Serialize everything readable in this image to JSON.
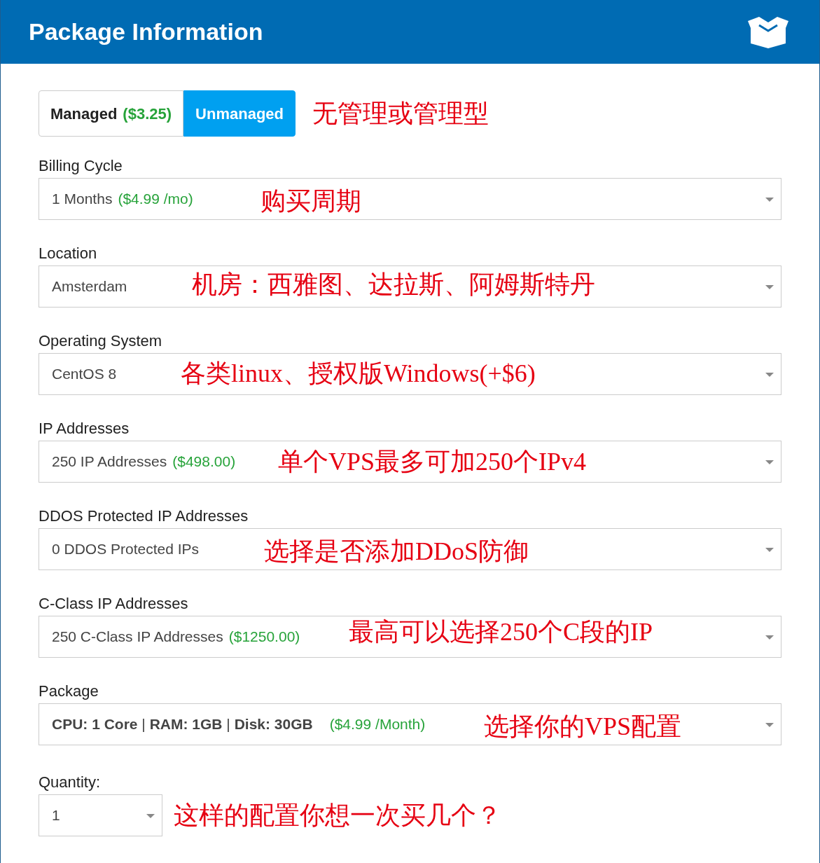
{
  "header": {
    "title": "Package Information"
  },
  "management": {
    "options": [
      {
        "label": "Managed",
        "price": "($3.25)",
        "selected": false
      },
      {
        "label": "Unmanaged",
        "selected": true
      }
    ],
    "annotation": "无管理或管理型"
  },
  "fields": [
    {
      "label": "Billing Cycle",
      "value": "1 Months",
      "price": "($4.99 /mo)",
      "annotation": "购买周期"
    },
    {
      "label": "Location",
      "value": "Amsterdam",
      "annotation": "机房：西雅图、达拉斯、阿姆斯特丹"
    },
    {
      "label": "Operating System",
      "value": "CentOS 8",
      "annotation": "各类linux、授权版Windows(+$6)"
    },
    {
      "label": "IP Addresses",
      "value": "250 IP Addresses",
      "price": "($498.00)",
      "annotation": "单个VPS最多可加250个IPv4"
    },
    {
      "label": "DDOS Protected IP Addresses",
      "value": "0 DDOS Protected IPs",
      "annotation": "选择是否添加DDoS防御"
    },
    {
      "label": "C-Class IP Addresses",
      "value": "250 C-Class IP Addresses",
      "price": "($1250.00)",
      "annotation": "最高可以选择250个C段的IP"
    },
    {
      "label": "Package",
      "value": "**CPU: 1 Core** | **RAM: 1GB** | **Disk: 30GB**",
      "price": "($4.99 /Month)",
      "annotation": "选择你的VPS配置"
    }
  ],
  "quantity": {
    "label": "Quantity:",
    "value": "1",
    "annotation": "这样的配置你想一次买几个？"
  }
}
